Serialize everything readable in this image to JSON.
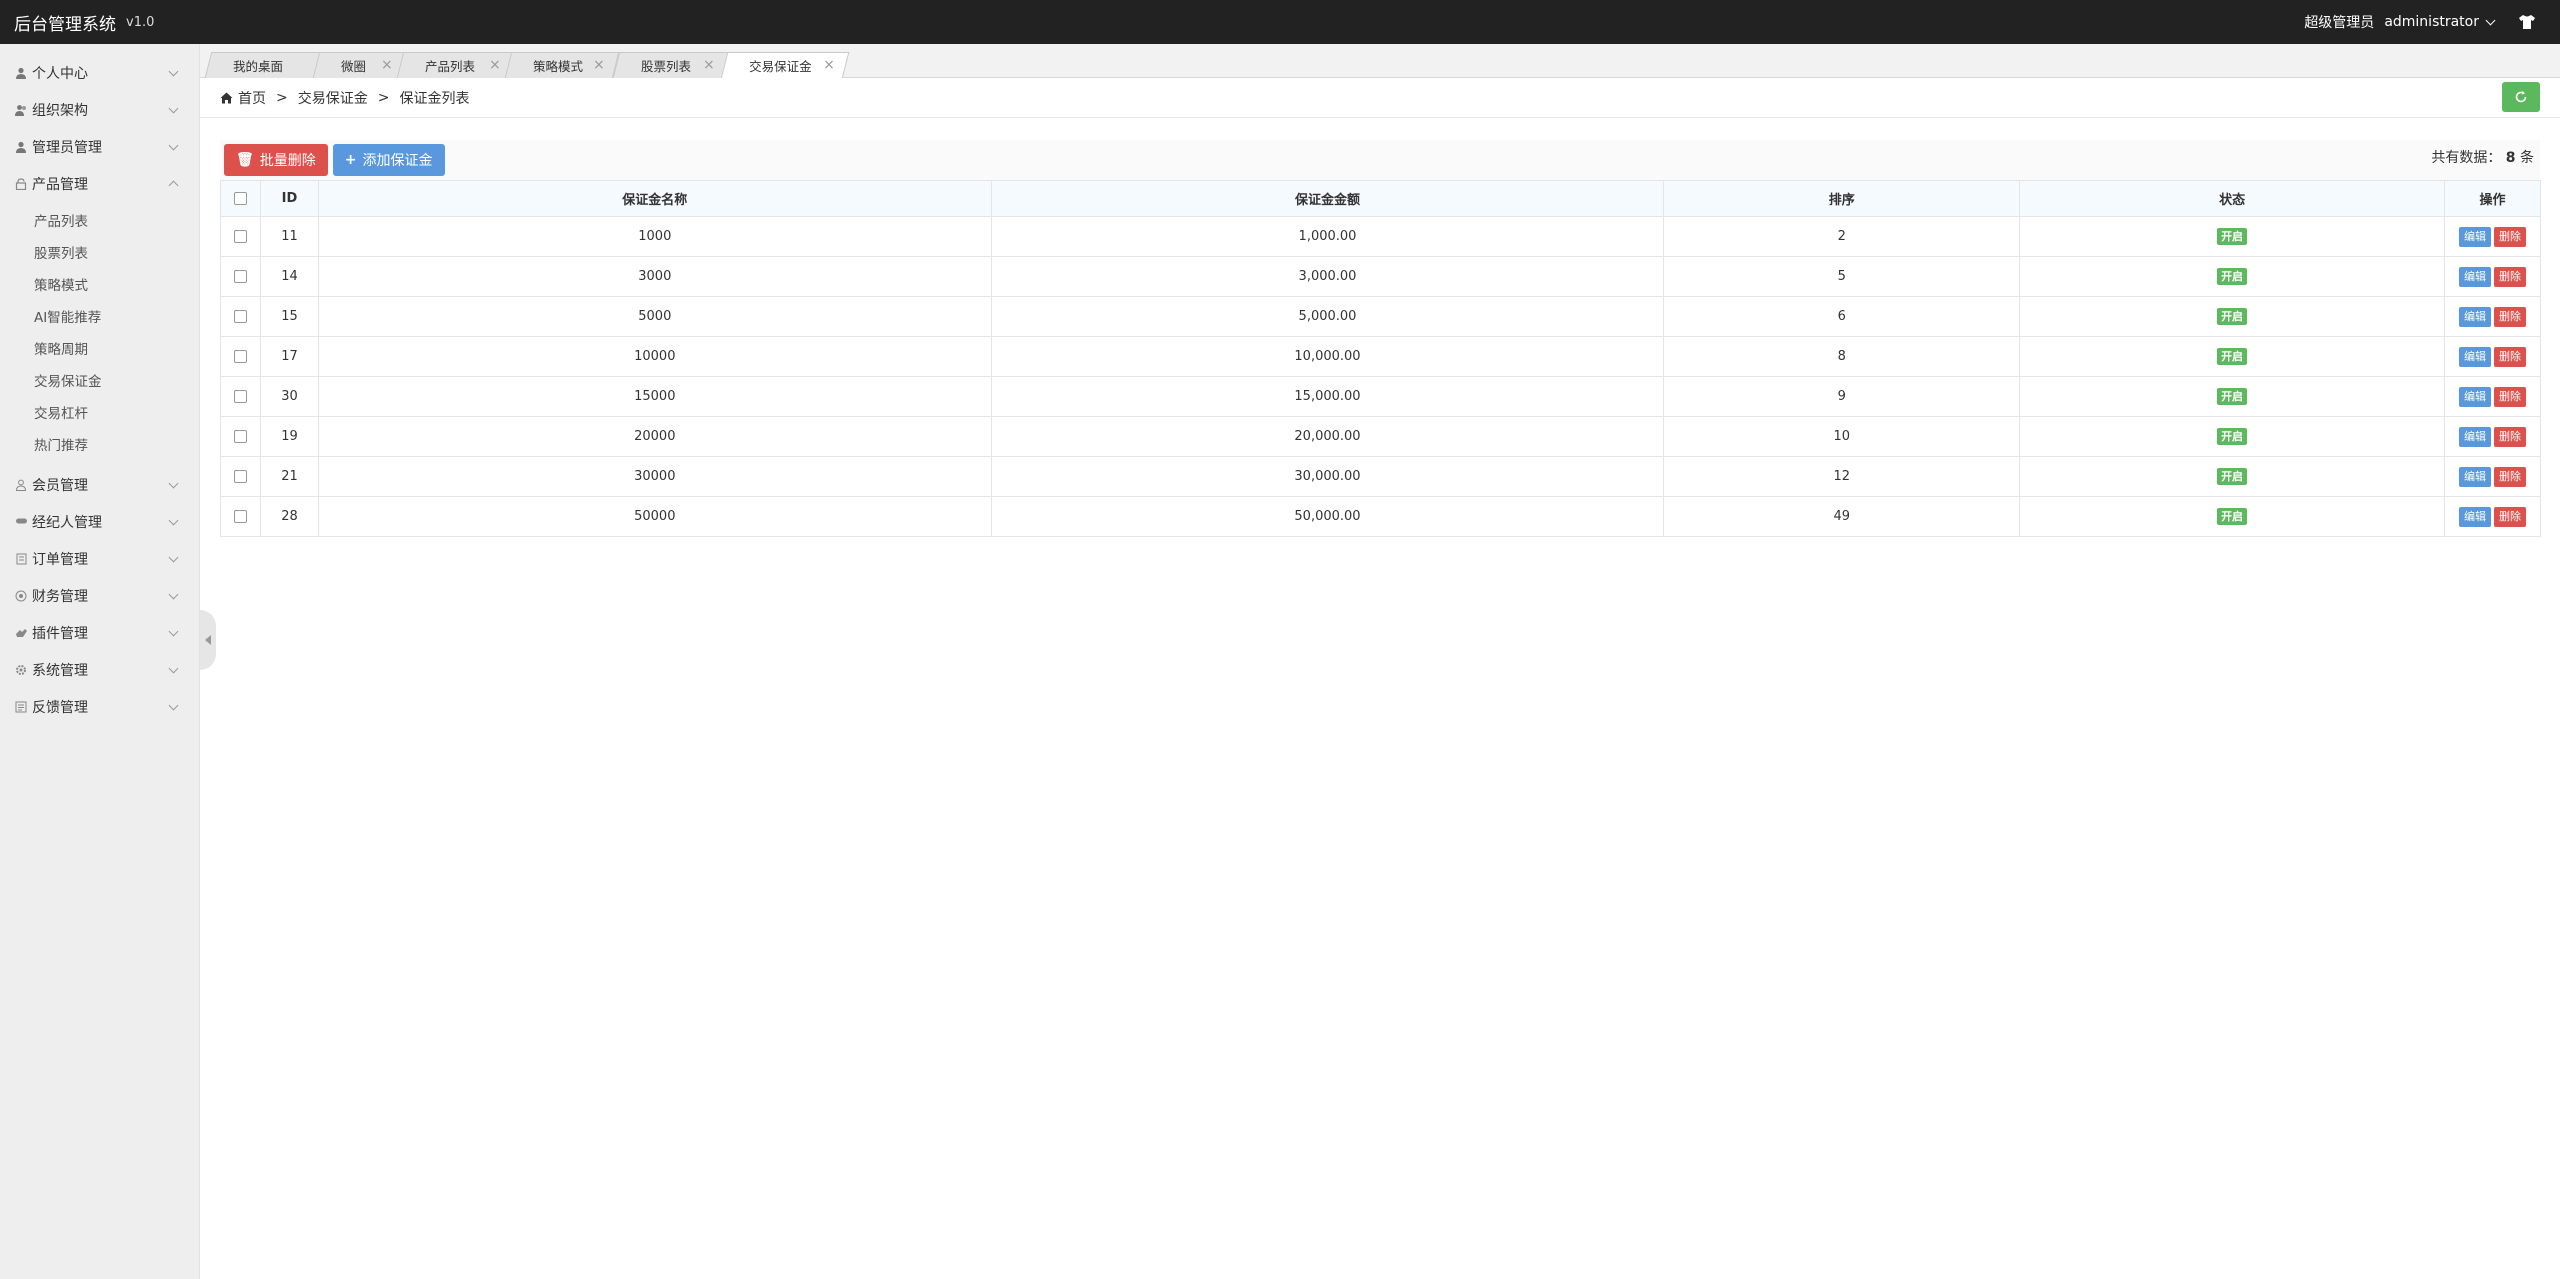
{
  "app": {
    "title": "后台管理系统",
    "version": "v1.0"
  },
  "user": {
    "role": "超级管理员",
    "name": "administrator"
  },
  "sidebar": {
    "menus": [
      {
        "label": "个人中心",
        "icon": "user-icon"
      },
      {
        "label": "组织架构",
        "icon": "users-icon"
      },
      {
        "label": "管理员管理",
        "icon": "user-icon"
      },
      {
        "label": "产品管理",
        "icon": "lock-icon"
      },
      {
        "label": "会员管理",
        "icon": "user-outline-icon"
      },
      {
        "label": "经纪人管理",
        "icon": "group-icon"
      },
      {
        "label": "订单管理",
        "icon": "file-icon"
      },
      {
        "label": "财务管理",
        "icon": "coin-icon"
      },
      {
        "label": "插件管理",
        "icon": "hand-icon"
      },
      {
        "label": "系统管理",
        "icon": "gear-icon"
      },
      {
        "label": "反馈管理",
        "icon": "feedback-icon"
      }
    ],
    "product_sub": [
      "产品列表",
      "股票列表",
      "策略模式",
      "AI智能推荐",
      "策略周期",
      "交易保证金",
      "交易杠杆",
      "热门推荐"
    ]
  },
  "tabs": [
    {
      "label": "我的桌面",
      "closable": false
    },
    {
      "label": "微圈",
      "closable": true
    },
    {
      "label": "产品列表",
      "closable": true
    },
    {
      "label": "策略模式",
      "closable": true
    },
    {
      "label": "股票列表",
      "closable": true
    },
    {
      "label": "交易保证金",
      "closable": true,
      "active": true
    }
  ],
  "breadcrumb": {
    "home": "首页",
    "sep": ">",
    "level1": "交易保证金",
    "level2": "保证金列表"
  },
  "toolbar": {
    "batch_delete": "批量删除",
    "add": "添加保证金",
    "total_prefix": "共有数据：",
    "total_count": "8",
    "total_suffix": "条"
  },
  "table": {
    "headers": [
      "ID",
      "保证金名称",
      "保证金金额",
      "排序",
      "状态",
      "操作"
    ],
    "rows": [
      {
        "id": "11",
        "name": "1000",
        "amount": "1,000.00",
        "sort": "2",
        "status": "开启"
      },
      {
        "id": "14",
        "name": "3000",
        "amount": "3,000.00",
        "sort": "5",
        "status": "开启"
      },
      {
        "id": "15",
        "name": "5000",
        "amount": "5,000.00",
        "sort": "6",
        "status": "开启"
      },
      {
        "id": "17",
        "name": "10000",
        "amount": "10,000.00",
        "sort": "8",
        "status": "开启"
      },
      {
        "id": "30",
        "name": "15000",
        "amount": "15,000.00",
        "sort": "9",
        "status": "开启"
      },
      {
        "id": "19",
        "name": "20000",
        "amount": "20,000.00",
        "sort": "10",
        "status": "开启"
      },
      {
        "id": "21",
        "name": "30000",
        "amount": "30,000.00",
        "sort": "12",
        "status": "开启"
      },
      {
        "id": "28",
        "name": "50000",
        "amount": "50,000.00",
        "sort": "49",
        "status": "开启"
      }
    ],
    "edit_label": "编辑",
    "delete_label": "删除"
  },
  "colors": {
    "topbar": "#222222",
    "danger": "#dd514c",
    "primary": "#5a98de",
    "success": "#5eb95e"
  }
}
